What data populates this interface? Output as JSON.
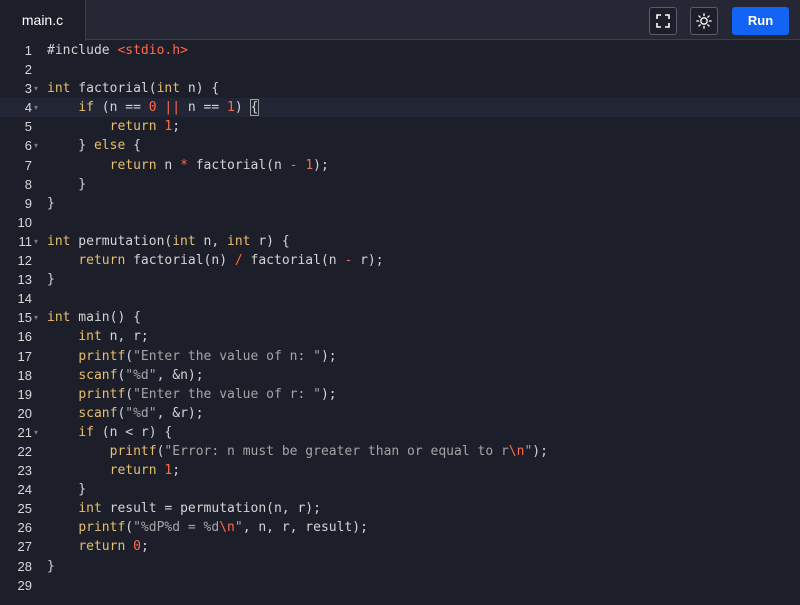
{
  "tab": {
    "filename": "main.c"
  },
  "toolbar": {
    "fullscreen_icon": "fullscreen-icon",
    "theme_icon": "sun-icon",
    "run_label": "Run"
  },
  "colors": {
    "run_button": "#1264f5",
    "background": "#1c1e2a",
    "keyword": "#e8bf6a",
    "number": "#ff6a48"
  },
  "editor": {
    "active_line": 4,
    "lines": [
      {
        "n": "1",
        "fold": false,
        "code": "#include <stdio.h>"
      },
      {
        "n": "2",
        "fold": false,
        "code": ""
      },
      {
        "n": "3",
        "fold": true,
        "code": "int factorial(int n) {"
      },
      {
        "n": "4",
        "fold": true,
        "code": "    if (n == 0 || n == 1) {"
      },
      {
        "n": "5",
        "fold": false,
        "code": "        return 1;"
      },
      {
        "n": "6",
        "fold": true,
        "code": "    } else {"
      },
      {
        "n": "7",
        "fold": false,
        "code": "        return n * factorial(n - 1);"
      },
      {
        "n": "8",
        "fold": false,
        "code": "    }"
      },
      {
        "n": "9",
        "fold": false,
        "code": "}"
      },
      {
        "n": "10",
        "fold": false,
        "code": ""
      },
      {
        "n": "11",
        "fold": true,
        "code": "int permutation(int n, int r) {"
      },
      {
        "n": "12",
        "fold": false,
        "code": "    return factorial(n) / factorial(n - r);"
      },
      {
        "n": "13",
        "fold": false,
        "code": "}"
      },
      {
        "n": "14",
        "fold": false,
        "code": ""
      },
      {
        "n": "15",
        "fold": true,
        "code": "int main() {"
      },
      {
        "n": "16",
        "fold": false,
        "code": "    int n, r;"
      },
      {
        "n": "17",
        "fold": false,
        "code": "    printf(\"Enter the value of n: \");"
      },
      {
        "n": "18",
        "fold": false,
        "code": "    scanf(\"%d\", &n);"
      },
      {
        "n": "19",
        "fold": false,
        "code": "    printf(\"Enter the value of r: \");"
      },
      {
        "n": "20",
        "fold": false,
        "code": "    scanf(\"%d\", &r);"
      },
      {
        "n": "21",
        "fold": true,
        "code": "    if (n < r) {"
      },
      {
        "n": "22",
        "fold": false,
        "code": "        printf(\"Error: n must be greater than or equal to r\\n\");"
      },
      {
        "n": "23",
        "fold": false,
        "code": "        return 1;"
      },
      {
        "n": "24",
        "fold": false,
        "code": "    }"
      },
      {
        "n": "25",
        "fold": false,
        "code": "    int result = permutation(n, r);"
      },
      {
        "n": "26",
        "fold": false,
        "code": "    printf(\"%dP%d = %d\\n\", n, r, result);"
      },
      {
        "n": "27",
        "fold": false,
        "code": "    return 0;"
      },
      {
        "n": "28",
        "fold": false,
        "code": "}"
      },
      {
        "n": "29",
        "fold": false,
        "code": ""
      }
    ]
  }
}
